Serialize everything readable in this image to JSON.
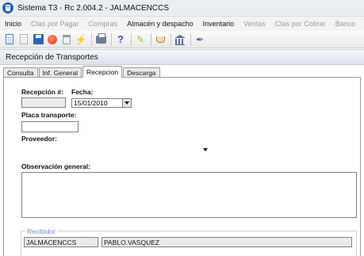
{
  "window": {
    "title": "Sistema T3 - Rc 2.004.2 - JALMACENCCS"
  },
  "menu": [
    {
      "label": "Inicio",
      "enabled": true
    },
    {
      "label": "Ctas por Pagar",
      "enabled": false
    },
    {
      "label": "Compras",
      "enabled": false
    },
    {
      "label": "Almacén y despacho",
      "enabled": true
    },
    {
      "label": "Inventario",
      "enabled": true
    },
    {
      "label": "Ventas",
      "enabled": false
    },
    {
      "label": "Ctas por Cobrar",
      "enabled": false
    },
    {
      "label": "Banco",
      "enabled": false
    }
  ],
  "toolbar": {
    "icons": [
      "new-document-icon",
      "copy-document-icon",
      "save-icon",
      "record-icon",
      "delete-icon",
      "process-icon",
      "print-icon",
      "help-icon",
      "clean-icon",
      "cup-icon",
      "bank-icon",
      "tools-icon"
    ]
  },
  "panel": {
    "title": "Recepción de Transportes"
  },
  "tabs": [
    {
      "label": "Consulta",
      "active": false
    },
    {
      "label": "Inf. General",
      "active": false
    },
    {
      "label": "Recepcion",
      "active": true
    },
    {
      "label": "Descarga",
      "active": false
    }
  ],
  "form": {
    "recepcion_label": "Recepción #:",
    "recepcion_value": "",
    "fecha_label": "Fecha:",
    "fecha_value": "15/01/2010",
    "placa_label": "Placa transporte:",
    "placa_value": "",
    "proveedor_label": "Proveedor:",
    "proveedor_value": "",
    "observacion_label": "Observación general:",
    "observacion_value": ""
  },
  "recibidor": {
    "legend": "Recibidor",
    "code": "JALMACENCCS",
    "name": "PABLO.VASQUEZ"
  },
  "colors": {
    "titlebar": "#eaeef3",
    "legend_text": "#6a8bbf",
    "readonly_field": "#ebebeb"
  }
}
